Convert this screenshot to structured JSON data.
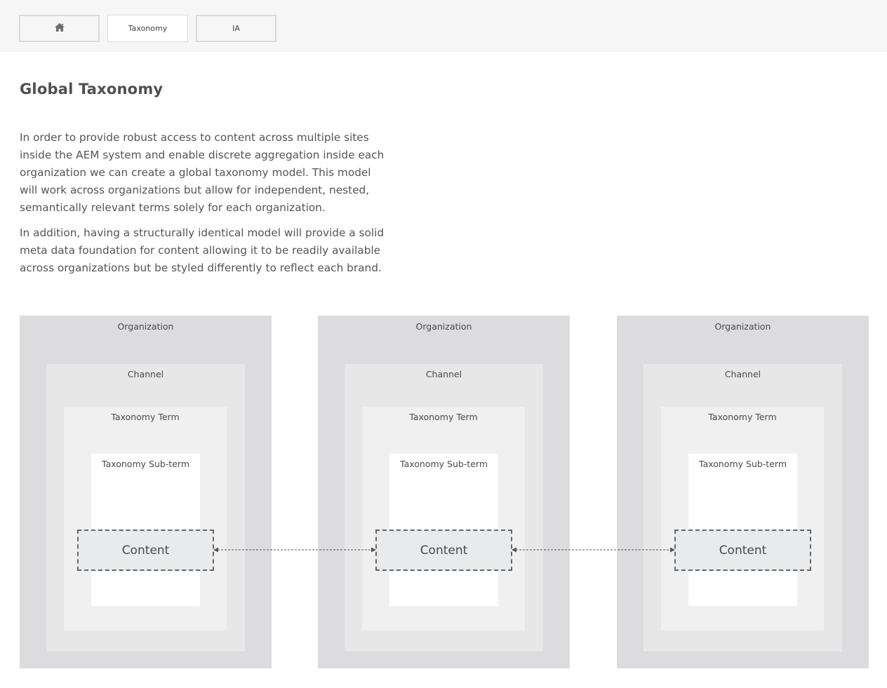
{
  "nav": {
    "home_icon": "home-icon",
    "tabs": [
      {
        "label": ""
      },
      {
        "label": "Taxonomy"
      },
      {
        "label": "IA"
      }
    ]
  },
  "page": {
    "title": "Global Taxonomy",
    "paragraphs": [
      "In order to provide robust access to content across multiple sites inside the AEM system and enable discrete aggregation inside each organization we can create a global taxonomy model. This model will work across organizations but allow for independent, nested, semantically relevant terms solely for each organization.",
      "In addition, having a structurally identical model will provide a solid meta data foundation for content allowing it to be readily available across organizations but be styled differently to reflect each brand."
    ]
  },
  "diagram": {
    "columns": [
      {
        "organization": "Organization",
        "channel": "Channel",
        "term": "Taxonomy Term",
        "subterm": "Taxonomy Sub-term",
        "content": "Content"
      },
      {
        "organization": "Organization",
        "channel": "Channel",
        "term": "Taxonomy Term",
        "subterm": "Taxonomy Sub-term",
        "content": "Content"
      },
      {
        "organization": "Organization",
        "channel": "Channel",
        "term": "Taxonomy Term",
        "subterm": "Taxonomy Sub-term",
        "content": "Content"
      }
    ]
  },
  "colors": {
    "topbar": "#f6f6f6",
    "organization": "#dcdcde",
    "channel": "#e7e7e8",
    "term": "#f0f0f0",
    "subterm": "#ffffff",
    "content": "#e8eaec"
  }
}
